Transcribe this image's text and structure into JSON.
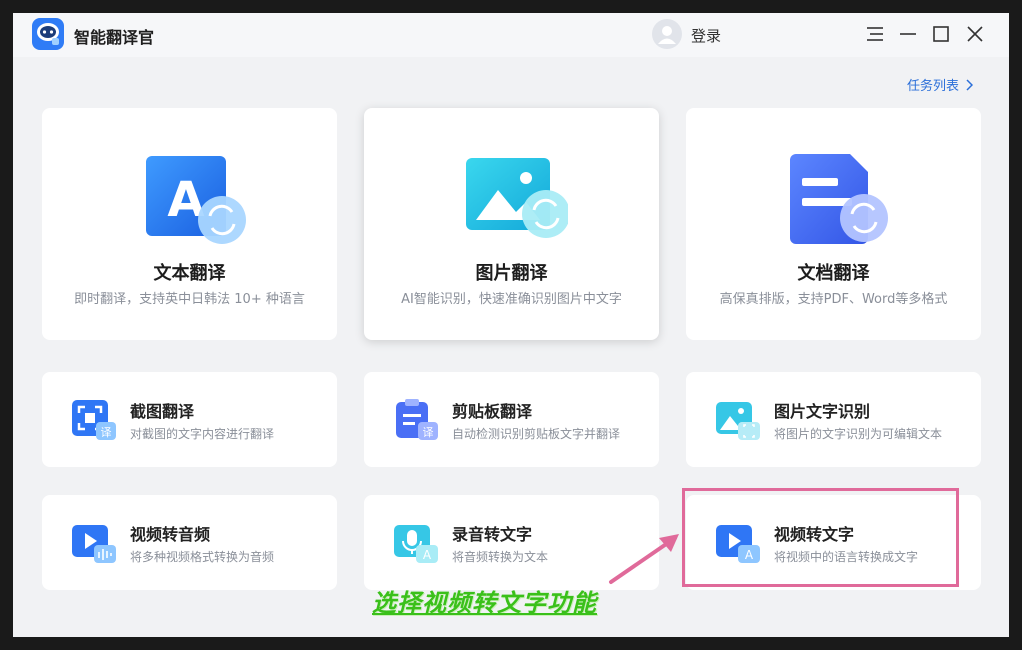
{
  "app": {
    "title": "智能翻译官",
    "login": "登录"
  },
  "header": {
    "task_list": "任务列表"
  },
  "big_cards": [
    {
      "title": "文本翻译",
      "subtitle": "即时翻译，支持英中日韩法 10+ 种语言"
    },
    {
      "title": "图片翻译",
      "subtitle": "AI智能识别，快速准确识别图片中文字"
    },
    {
      "title": "文档翻译",
      "subtitle": "高保真排版，支持PDF、Word等多格式"
    }
  ],
  "small_cards": [
    {
      "title": "截图翻译",
      "subtitle": "对截图的文字内容进行翻译",
      "badge": "译"
    },
    {
      "title": "剪贴板翻译",
      "subtitle": "自动检测识别剪贴板文字并翻译",
      "badge": "译"
    },
    {
      "title": "图片文字识别",
      "subtitle": "将图片的文字识别为可编辑文本"
    },
    {
      "title": "视频转音频",
      "subtitle": "将多种视频格式转换为音频"
    },
    {
      "title": "录音转文字",
      "subtitle": "将音频转换为文本",
      "badge": "A"
    },
    {
      "title": "视频转文字",
      "subtitle": "将视频中的语言转换成文字",
      "badge": "A"
    }
  ],
  "annotation": {
    "text": "选择视频转文字功能"
  },
  "colors": {
    "accent": "#2b6fd9",
    "highlight": "#e06a9a",
    "annotation": "#3ac01a"
  }
}
